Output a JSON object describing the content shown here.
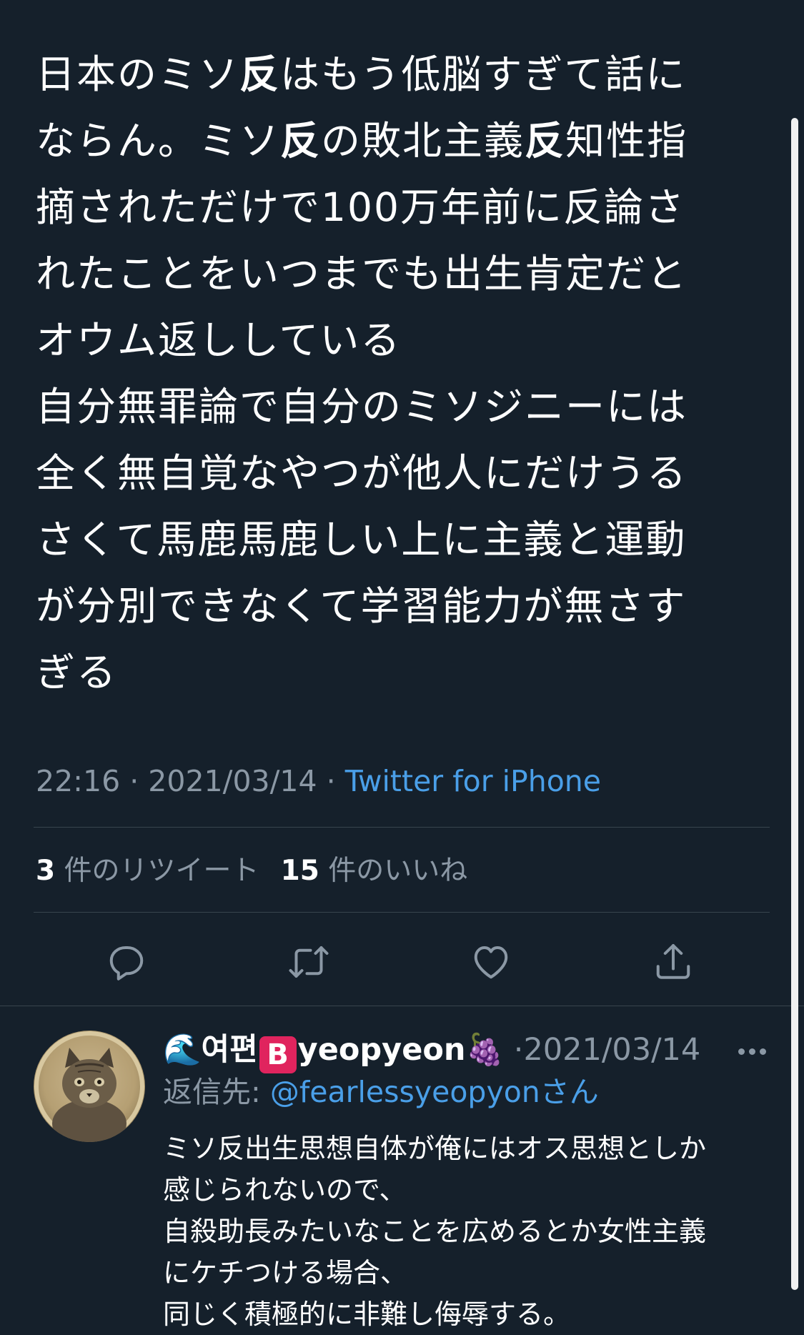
{
  "tweet": {
    "body_lines": [
      [
        "日本のミソ",
        "反",
        "はもう低脳すぎて話に"
      ],
      [
        "ならん。ミソ",
        "反",
        "の敗北主義",
        "反",
        "知性指"
      ],
      [
        "摘されただけで100万年前に反論さ"
      ],
      [
        "れたことをいつまでも出生肯定だと"
      ],
      [
        "オウム返ししている"
      ],
      [
        "自分無罪論で自分のミソジニーには"
      ],
      [
        "全く無自覚なやつが他人にだけうる"
      ],
      [
        "さくて馬鹿馬鹿しい上に主義と運動"
      ],
      [
        "が分別できなくて学習能力が無さす"
      ],
      [
        "ぎる"
      ]
    ],
    "time": "22:16",
    "separator": "·",
    "date": "2021/03/14",
    "source": "Twitter for iPhone",
    "retweet_count": "3",
    "retweet_label": "件のリツイート",
    "like_count": "15",
    "like_label": "件のいいね"
  },
  "actions": {
    "reply_icon": "reply-icon",
    "retweet_icon": "retweet-icon",
    "like_icon": "like-icon",
    "share_icon": "share-icon"
  },
  "reply": {
    "name_prefix_emoji": "🌊",
    "name_korean": "여편",
    "badge": "B",
    "name_latin": "yeopyeon",
    "name_suffix_emoji": "🍇",
    "separator": "·",
    "date": "2021/03/14",
    "replying_label": "返信先:",
    "replying_handle": "@fearlessyeopyon",
    "replying_suffix": "さん",
    "body_lines": [
      "ミソ反出生思想自体が俺にはオス思想としか",
      "感じられないので、",
      "自殺助長みたいなことを広めるとか女性主義",
      "にケチつける場合、",
      "同じく積極的に非難し侮辱する。"
    ]
  },
  "colors": {
    "background": "#15202b",
    "text": "#ffffff",
    "muted": "#8b98a5",
    "link": "#4a9fe8",
    "divider": "#38444d",
    "badge": "#e0245e"
  }
}
